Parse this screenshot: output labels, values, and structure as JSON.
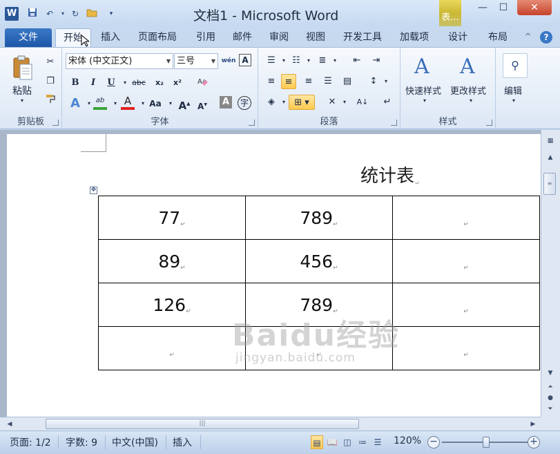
{
  "window": {
    "title": "文档1 - Microsoft Word",
    "contextual_tab_header": "表...",
    "app_logo": "W"
  },
  "quick_access": [
    "save-icon",
    "undo-icon",
    "redo-icon",
    "open-icon",
    "customize-icon"
  ],
  "tabs": {
    "file": "文件",
    "home": "开始",
    "insert": "插入",
    "page_layout": "页面布局",
    "references": "引用",
    "mailings": "邮件",
    "review": "审阅",
    "view": "视图",
    "developer": "开发工具",
    "addins": "加载项",
    "design": "设计",
    "layout": "布局"
  },
  "ribbon": {
    "clipboard": {
      "label": "剪贴板",
      "paste": "粘贴"
    },
    "font": {
      "label": "字体",
      "font_name": "宋体 (中文正文)",
      "font_size": "三号",
      "phonetic_glyph": "wén",
      "bold": "B",
      "italic": "I",
      "underline": "U",
      "strike": "abc",
      "subscript": "x₂",
      "superscript": "x²",
      "grow": "A",
      "shrink": "A",
      "change_case": "Aa",
      "enclose": "字",
      "highlight": "ab",
      "font_color": "A"
    },
    "paragraph": {
      "label": "段落"
    },
    "styles": {
      "label": "样式",
      "quick_styles": "快速样式",
      "change_styles": "更改样式"
    },
    "editing": {
      "label": "编辑"
    }
  },
  "document": {
    "title": "统计表",
    "table": [
      [
        "77",
        "789",
        ""
      ],
      [
        "89",
        "456",
        ""
      ],
      [
        "126",
        "789",
        ""
      ],
      [
        "",
        "",
        ""
      ]
    ],
    "watermark": "Baidu经验",
    "watermark_sub": "jingyan.baidu.com"
  },
  "statusbar": {
    "page": "页面: 1/2",
    "words": "字数: 9",
    "language": "中文(中国)",
    "mode": "插入",
    "zoom": "120%"
  },
  "colors": {
    "file_tab": "#2b62b1",
    "highlight_bar": "#3aa53a",
    "font_color_bar": "#e02020",
    "active_button": "#ffc94f"
  }
}
